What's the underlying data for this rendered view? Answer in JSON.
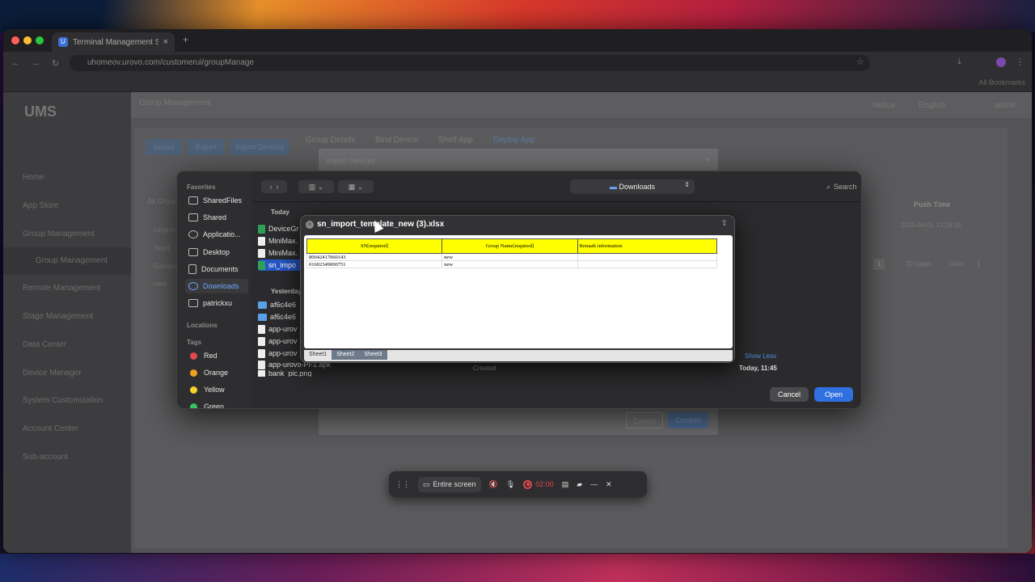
{
  "browser": {
    "tab_title": "Terminal Management System",
    "new_tab_icon": "+",
    "url": "uhomeov.urovo.com/customerui/groupManage",
    "bookmarks_label": "All Bookmarks"
  },
  "app": {
    "logo": "UMS",
    "header_title": "Group Management",
    "header_right": [
      "Notice",
      "English",
      "admin"
    ],
    "nav": [
      {
        "label": "Home"
      },
      {
        "label": "App Store"
      },
      {
        "label": "Group Management"
      },
      {
        "label": "Group Management"
      },
      {
        "label": "Remote Management"
      },
      {
        "label": "Stage Management"
      },
      {
        "label": "Data Center"
      },
      {
        "label": "Device Manager"
      },
      {
        "label": "System Customization"
      },
      {
        "label": "Account Center"
      },
      {
        "label": "Sub-account"
      }
    ],
    "toolbar_buttons": [
      "Import",
      "Export",
      "Import Devices"
    ],
    "tabs": [
      "Group Details",
      "Bind Device",
      "Shelf App",
      "Deploy App"
    ],
    "push_time_header": "Push Time",
    "push_time_value": "2025-04-01 13:29:33",
    "pagination": {
      "page": "1",
      "per_page": "10 /page",
      "goto_label": "Goto",
      "goto_value": "1"
    },
    "tree": [
      "All Group",
      "Ungroup",
      "Test1",
      "GroupA",
      "new"
    ],
    "import_dialog": {
      "title": "Import Devices",
      "cancel": "Cancel",
      "confirm": "Confirm"
    }
  },
  "finder": {
    "favorites_label": "Favorites",
    "favorites": [
      "SharedFiles",
      "Shared",
      "Applicatio...",
      "Desktop",
      "Documents",
      "Downloads",
      "patrickxu"
    ],
    "locations_label": "Locations",
    "tags_label": "Tags",
    "tags": [
      {
        "label": "Red",
        "color": "#e0484e"
      },
      {
        "label": "Orange",
        "color": "#f0a020"
      },
      {
        "label": "Yellow",
        "color": "#f5d22a"
      },
      {
        "label": "Green",
        "color": "#3cc060"
      }
    ],
    "location": "Downloads",
    "search_label": "Search",
    "group_today": "Today",
    "group_yesterday": "Yesterday",
    "files_today": [
      "DeviceGr",
      "MiniMax.",
      "MiniMax.",
      "sn_impo"
    ],
    "files_yesterday": [
      "af6c4e6",
      "af6c4e6",
      "app-urov",
      "app-urov",
      "app-urov",
      "app-urovo-PI-1.apk",
      "bank_pic.png"
    ],
    "show_less": "Show Less",
    "created_label": "Created",
    "created_value": "Today, 11:45",
    "cancel_label": "Cancel",
    "open_label": "Open"
  },
  "quicklook": {
    "title": "sn_import_template_new (3).xlsx",
    "columns": [
      "SN[required]",
      "Group Name[required]",
      "Remark information"
    ],
    "rows": [
      [
        "80042417060143",
        "new",
        ""
      ],
      [
        "01602349000751",
        "new",
        ""
      ]
    ],
    "sheets": [
      "Sheet1",
      "Sheet2",
      "Sheet3"
    ]
  },
  "recorder": {
    "screen_label": "Entire screen",
    "time": "02:00"
  }
}
